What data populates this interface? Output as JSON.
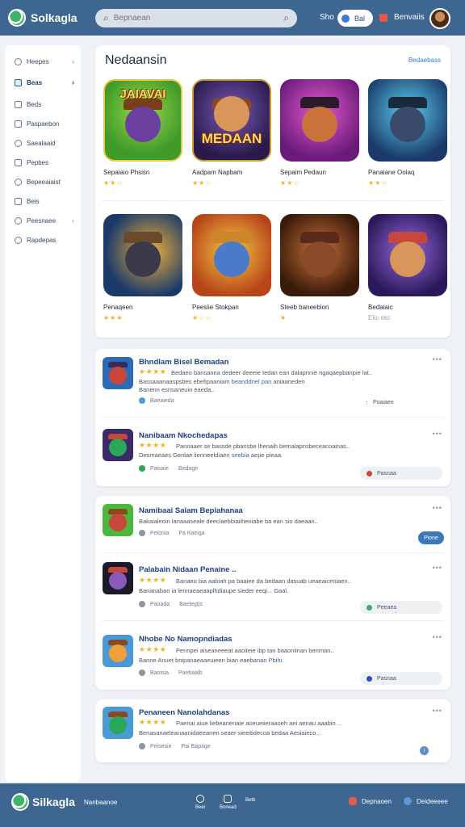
{
  "header": {
    "brand": "Solkagla",
    "search_placeholder": "Bepnaean",
    "link1": "Sho",
    "pill_label": "Bal",
    "account_link": "Benvaiis"
  },
  "sidebar": {
    "items": [
      {
        "label": "Heepes"
      },
      {
        "label": "Beas"
      },
      {
        "label": "Beds"
      },
      {
        "label": "Paspaebon"
      },
      {
        "label": "Saealaaid"
      },
      {
        "label": "Pepbes"
      },
      {
        "label": "Bepeeaiaist"
      },
      {
        "label": "Beis"
      },
      {
        "label": "Peesnaee"
      },
      {
        "label": "Rapdepas"
      }
    ]
  },
  "featured": {
    "title": "Nedaansin",
    "view_all": "Bedaebass",
    "games": [
      {
        "name": "Sepaiaio Phsisn",
        "stars": "★★☆",
        "overlay": "JAIAVAI"
      },
      {
        "name": "Aadpam Napbam",
        "stars": "★★☆",
        "overlay": "MEDAAN"
      },
      {
        "name": "Sepaim Pedaun",
        "stars": "★★☆",
        "overlay": ""
      },
      {
        "name": "Panaiane Ooiaq",
        "stars": "★★☆",
        "overlay": ""
      },
      {
        "name": "Penaqeen",
        "stars": "★★★",
        "overlay": ""
      },
      {
        "name": "Peesiie Stokpan",
        "stars": "★☆☆",
        "overlay": ""
      },
      {
        "name": "Steeb baneebion",
        "stars": "★",
        "overlay": ""
      },
      {
        "name": "Bedaiaic",
        "stars": "Ekc ekc",
        "overlay": ""
      }
    ]
  },
  "reviews_a": [
    {
      "title": "Bhndlam Bisel Bemadan",
      "stars": "★★★★",
      "line1": "Bedaeo bansanna dedeer deeeie tedan ean dalapnnie ngaqaepbanpie lat..",
      "line2a": "Bassaaanaaspsbes ebefipaaniam ",
      "line2b": "beanddnel pan",
      "line2c": " aniaaneden",
      "line3": "Banenn esnsaneuin eaeda..",
      "meta1": "Baeaieda",
      "meta2": "",
      "tag": "Poaiaen",
      "dots": "•••"
    },
    {
      "title": "Nanibaam Nkochedapas",
      "stars": "★★★★",
      "line1": "Pannaaer se bassde pbansbe lhenaih bemaiapnsbeceacoainas..",
      "line2a": "Desmaeaes Genlae lienneeldiaen ",
      "line2b": "seebia",
      "line2c": " aepe pieaa.",
      "line3": "",
      "meta1": "Paisaie",
      "meta2": "Bedage",
      "tag": "Pasnaa",
      "dots": "•••"
    }
  ],
  "reviews_b": [
    {
      "title": "Namibaai Saiam Bepiahanaa",
      "stars": "",
      "line1": "Bakaialeoin lanaaaseale deeclaebbiaiiheniabe ba ean sio daeaan..",
      "line2a": "",
      "line2b": "",
      "line2c": "",
      "line3": "",
      "meta1": "Peionia",
      "meta2": "Pa Kaeiga",
      "tag": "Pione",
      "dots": "•••"
    },
    {
      "title": "Palabain Nidaan Penaine ..",
      "stars": "★★★★",
      "line1": "Banaeo bia aabiah pa baaiee da bedaan dasuab ueaeaiceniaen..",
      "line2a": "Bananaban ia lennaeaeaaplhdiaupe sieder eeqi... Gaal.",
      "line2b": "",
      "line2c": "",
      "line3": "",
      "meta1": "Paoada",
      "meta2": "Baelegtjs",
      "tag": "Peeaea",
      "dots": "•••"
    },
    {
      "title": "Nhobe No Namopndiadas",
      "stars": "★★★★",
      "line1": "Pennpei aiseaneeeat aaoiteie ibp tan baaoniinan benman..",
      "line2a": "Banne Anuet bnipanaeaaeuieen bian eaebanan ",
      "line2b": "Pbihi.",
      "line2c": "",
      "line3": "",
      "meta1": "Baoisia",
      "meta2": "Paebaalb",
      "tag": "Pasnaa",
      "dots": "•••"
    },
    {
      "title": "Penaneen Nanolahdanas",
      "stars": "★★★★",
      "line1": "Paenai aiue liebeanenaie aoeueiieraaoeh aei aenau aaabin ...",
      "line2a": "Benasanaeleanaanidaeeanen seaer sieeitidecoa bedaa Aesiaieco...",
      "line2b": "",
      "line2c": "",
      "line3": "",
      "meta1": "Peisesie",
      "meta2": "Pai Bapage",
      "tag": "",
      "dots": "•••"
    }
  ],
  "footer": {
    "brand": "Silkagla",
    "link1": "Nanbaanoe",
    "nav": [
      {
        "label": "Beei"
      },
      {
        "label": "Bonead"
      },
      {
        "label": "Betb"
      }
    ],
    "right1": "Depnaoen",
    "right2": "Deideeeee"
  },
  "colors": {
    "header_bg": "#3d6690",
    "accent": "#3d79d6",
    "star": "#f2b21c"
  }
}
